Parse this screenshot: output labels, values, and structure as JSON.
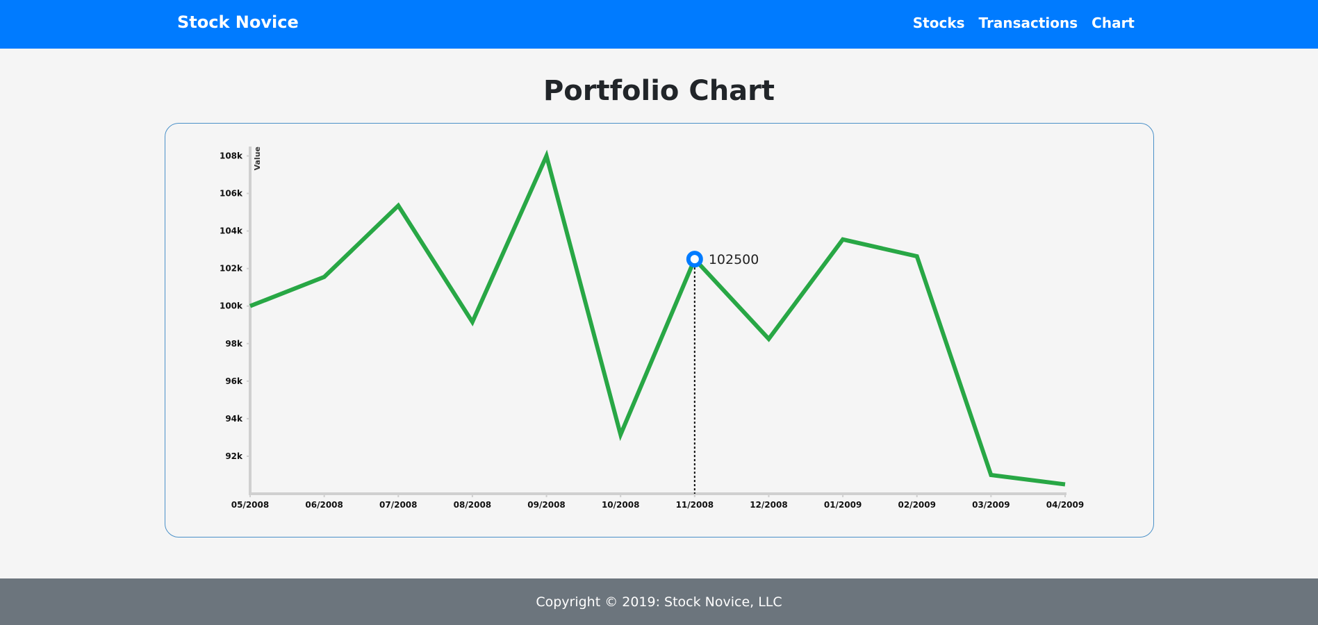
{
  "navbar": {
    "brand": "Stock Novice",
    "links": [
      "Stocks",
      "Transactions",
      "Chart"
    ],
    "color": "#007bff"
  },
  "page": {
    "title": "Portfolio Chart"
  },
  "footer": {
    "text": "Copyright © 2019: Stock Novice, LLC"
  },
  "chart_data": {
    "type": "line",
    "title": "",
    "xlabel": "",
    "ylabel": "Value",
    "categories": [
      "05/2008",
      "06/2008",
      "07/2008",
      "08/2008",
      "09/2008",
      "10/2008",
      "11/2008",
      "12/2008",
      "01/2009",
      "02/2009",
      "03/2009",
      "04/2009"
    ],
    "series": [
      {
        "color": "#28a745",
        "values": [
          100000,
          101550,
          105350,
          99150,
          108000,
          93150,
          102500,
          98250,
          103550,
          102650,
          91000,
          90500
        ]
      }
    ],
    "ylim": [
      90000,
      108500
    ],
    "y_ticks": [
      92000,
      94000,
      96000,
      98000,
      100000,
      102000,
      104000,
      106000,
      108000
    ],
    "y_tick_labels": [
      "92k",
      "94k",
      "96k",
      "98k",
      "100k",
      "102k",
      "104k",
      "106k",
      "108k"
    ],
    "highlight": {
      "index": 6,
      "label": "102500",
      "color": "#007bff"
    },
    "grid": false
  }
}
